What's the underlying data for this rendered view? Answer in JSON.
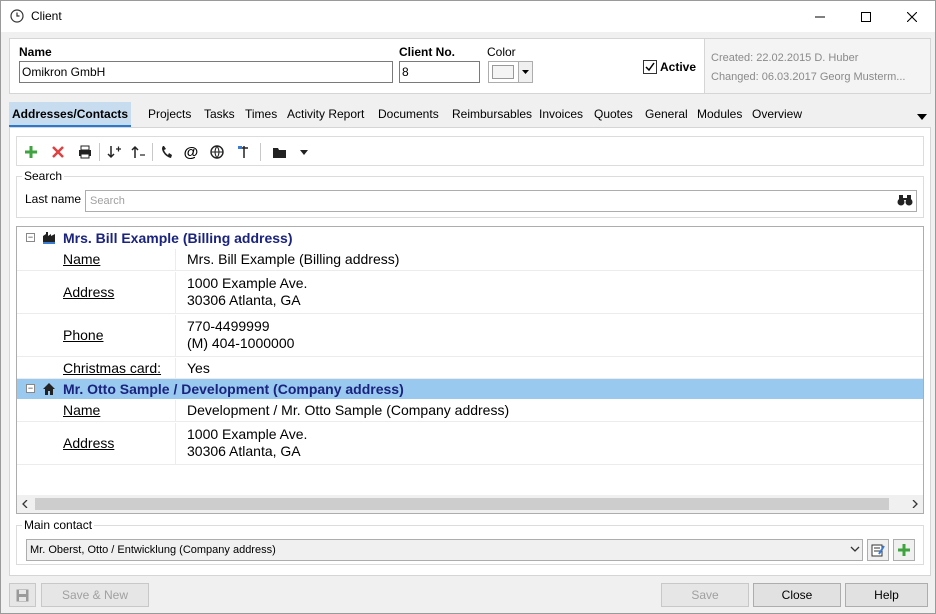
{
  "window": {
    "title": "Client"
  },
  "header": {
    "name_label": "Name",
    "name_value": "Omikron GmbH",
    "client_no_label": "Client No.",
    "client_no_value": "8",
    "color_label": "Color",
    "active_label": "Active",
    "active_checked": true,
    "created": "Created: 22.02.2015 D.  Huber",
    "changed": "Changed: 06.03.2017 Georg Musterm..."
  },
  "tabs": [
    {
      "label": "Addresses/Contacts",
      "active": true
    },
    {
      "label": "Projects"
    },
    {
      "label": "Tasks"
    },
    {
      "label": "Times"
    },
    {
      "label": "Activity Report"
    },
    {
      "label": "Documents"
    },
    {
      "label": "Reimbursables"
    },
    {
      "label": "Invoices"
    },
    {
      "label": "Quotes"
    },
    {
      "label": "General"
    },
    {
      "label": "Modules"
    },
    {
      "label": "Overview"
    }
  ],
  "toolbar": {
    "icons": [
      "add-icon",
      "delete-icon",
      "print-icon",
      "sort-descending-icon",
      "sort-ascending-icon",
      "phone-icon",
      "email-icon",
      "web-icon",
      "map-pin-icon",
      "folder-icon",
      "dropdown-icon"
    ]
  },
  "search": {
    "group_label": "Search",
    "last_name_label": "Last name",
    "placeholder": "Search"
  },
  "contacts": [
    {
      "header": "Mrs. Bill Example (Billing address)",
      "selected": false,
      "fields": [
        {
          "key": "Name",
          "lines": [
            "Mrs. Bill Example (Billing address)"
          ]
        },
        {
          "key": "Address",
          "lines": [
            "1000 Example Ave.",
            "30306 Atlanta, GA"
          ]
        },
        {
          "key": "Phone",
          "lines": [
            "770-4499999",
            "(M) 404-1000000"
          ]
        },
        {
          "key": "Christmas card:",
          "lines": [
            "Yes"
          ]
        }
      ]
    },
    {
      "header": "Mr. Otto Sample / Development (Company address)",
      "selected": true,
      "fields": [
        {
          "key": "Name",
          "lines": [
            "Development / Mr. Otto Sample (Company address)"
          ]
        },
        {
          "key": "Address",
          "lines": [
            "1000 Example Ave.",
            "30306 Atlanta, GA"
          ]
        }
      ]
    }
  ],
  "main_contact": {
    "group_label": "Main contact",
    "value": "Mr. Oberst, Otto / Entwicklung (Company address)"
  },
  "buttons": {
    "save_new": "Save & New",
    "save": "Save",
    "close": "Close",
    "help": "Help"
  },
  "colors": {
    "accent": "#2b78d0",
    "selected_row": "#99c9ef",
    "active_tab": "#c8dcf0",
    "contact_header_text": "#1a237e"
  }
}
